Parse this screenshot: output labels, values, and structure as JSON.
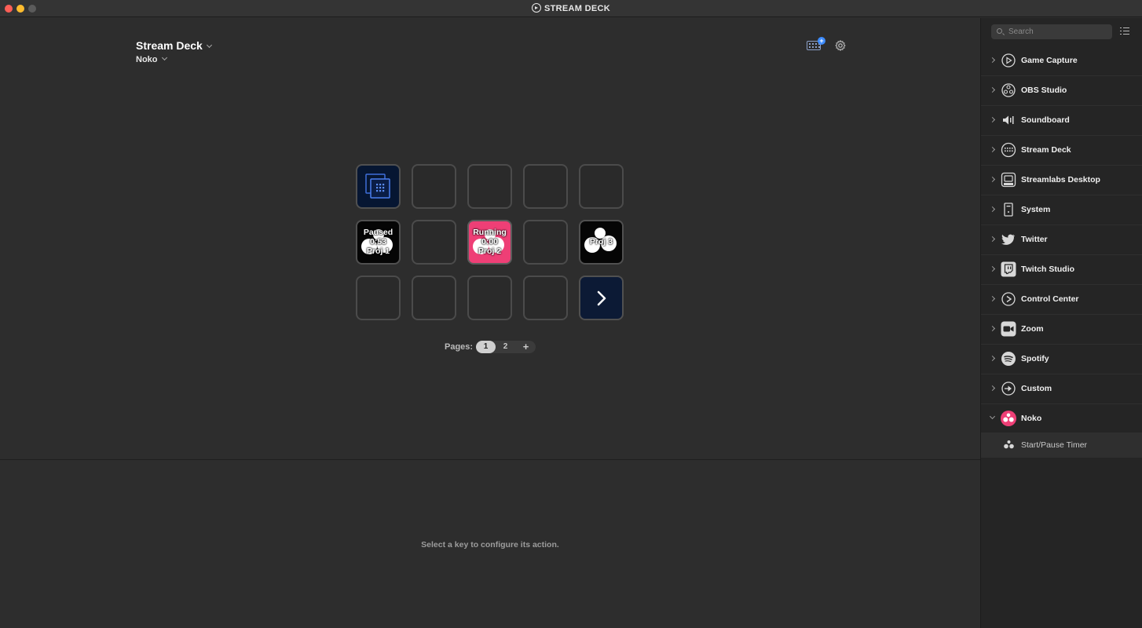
{
  "window": {
    "title": "STREAM DECK"
  },
  "header": {
    "device": "Stream Deck",
    "profile": "Noko",
    "kbd_badge": "+"
  },
  "keys": [
    {
      "text": ""
    },
    {
      "text": ""
    },
    {
      "text": ""
    },
    {
      "text": ""
    },
    {
      "text": ""
    },
    {
      "text": "Paused\n0:53\nProj 1"
    },
    {
      "text": ""
    },
    {
      "text": "Running\n0:00\nProj 2"
    },
    {
      "text": ""
    },
    {
      "text": "Proj 3"
    },
    {
      "text": ""
    },
    {
      "text": ""
    },
    {
      "text": ""
    },
    {
      "text": ""
    },
    {
      "text": ""
    }
  ],
  "pages": {
    "label": "Pages:",
    "items": [
      "1",
      "2"
    ],
    "add": "+"
  },
  "config": {
    "message": "Select a key to configure its action."
  },
  "sidebar": {
    "search_placeholder": "Search",
    "categories": [
      {
        "label": "Game Capture",
        "icon": "game-capture-icon"
      },
      {
        "label": "OBS Studio",
        "icon": "obs-studio-icon"
      },
      {
        "label": "Soundboard",
        "icon": "soundboard-icon"
      },
      {
        "label": "Stream Deck",
        "icon": "stream-deck-icon"
      },
      {
        "label": "Streamlabs Desktop",
        "icon": "streamlabs-icon"
      },
      {
        "label": "System",
        "icon": "system-icon"
      },
      {
        "label": "Twitter",
        "icon": "twitter-icon"
      },
      {
        "label": "Twitch Studio",
        "icon": "twitch-icon"
      },
      {
        "label": "Control Center",
        "icon": "control-center-icon"
      },
      {
        "label": "Zoom",
        "icon": "zoom-icon"
      },
      {
        "label": "Spotify",
        "icon": "spotify-icon"
      },
      {
        "label": "Custom",
        "icon": "custom-icon"
      },
      {
        "label": "Noko",
        "icon": "noko-icon"
      }
    ],
    "action": {
      "label": "Start/Pause Timer",
      "icon": "noko-timer-icon"
    }
  },
  "colors": {
    "noko_pink": "#ee3f76",
    "key_blue": "#061632",
    "badge_blue": "#3d8cff"
  }
}
